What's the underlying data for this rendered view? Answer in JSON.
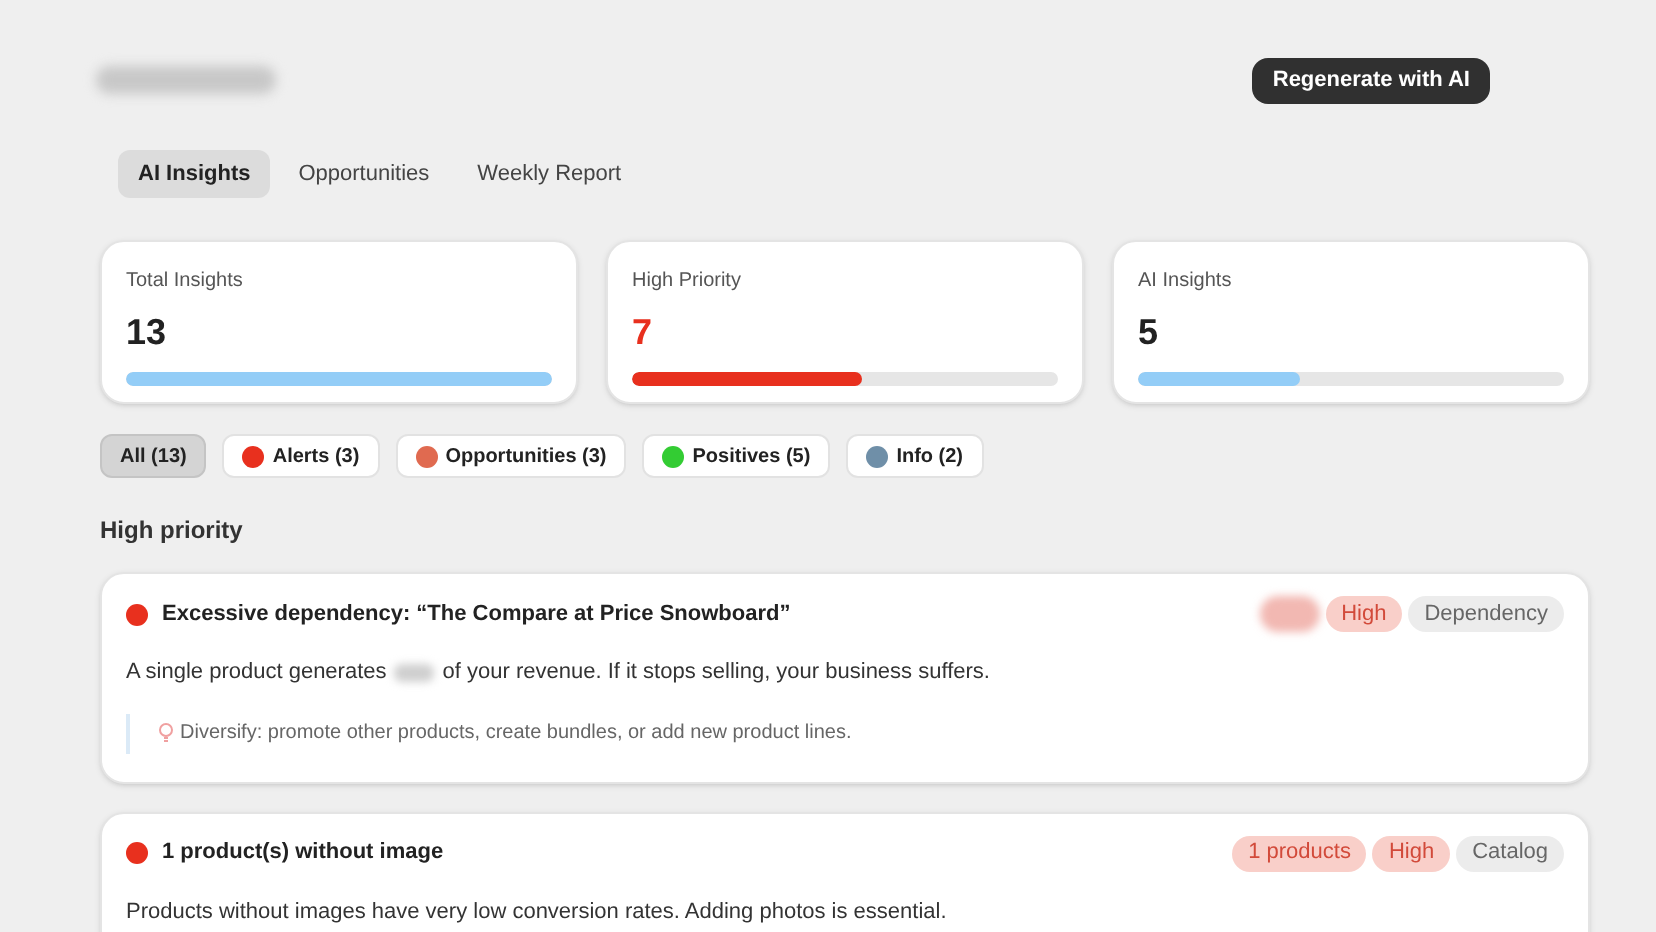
{
  "header": {
    "action": "Regenerate with AI"
  },
  "tabs": [
    {
      "label": "AI Insights",
      "selected": true
    },
    {
      "label": "Opportunities",
      "selected": false
    },
    {
      "label": "Weekly Report",
      "selected": false
    }
  ],
  "stats": [
    {
      "label": "Total Insights",
      "value": "13",
      "level": 1.0,
      "color": "#93cdf7",
      "highlight": false
    },
    {
      "label": "High Priority",
      "value": "7",
      "level": 0.54,
      "color": "#e8301e",
      "highlight": true
    },
    {
      "label": "AI Insights",
      "value": "5",
      "level": 0.38,
      "color": "#93cdf7",
      "highlight": false
    }
  ],
  "filters": [
    {
      "label": "All (13)",
      "selected": true
    },
    {
      "label": "Alerts (3)",
      "selected": false,
      "color": "#e8301e"
    },
    {
      "label": "Opportunities (3)",
      "selected": false,
      "color": "#e06a50"
    },
    {
      "label": "Positives (5)",
      "selected": false,
      "color": "#33cc33"
    },
    {
      "label": "Info (2)",
      "selected": false,
      "color": "#6f8fa8"
    }
  ],
  "section_title": "High priority",
  "insights": [
    {
      "title": "Excessive dependency: “The Compare at Price Snowboard”",
      "color": "#e8301e",
      "badges": [
        {
          "kind": "redacted"
        },
        {
          "kind": "priority",
          "label": "High"
        },
        {
          "kind": "category",
          "label": "Dependency"
        }
      ],
      "text_before": "A single product generates",
      "text_redacted": true,
      "text_after": "of your revenue. If it stops selling, your business suffers.",
      "tip": "Diversify: promote other products, create bundles, or add new product lines."
    },
    {
      "title": "1 product(s) without image",
      "color": "#e8301e",
      "badges": [
        {
          "kind": "count",
          "label": "1 products"
        },
        {
          "kind": "priority",
          "label": "High"
        },
        {
          "kind": "category",
          "label": "Catalog"
        }
      ],
      "text_before": "Products without images have very low conversion rates. Adding photos is essential.",
      "text_redacted": false
    }
  ]
}
